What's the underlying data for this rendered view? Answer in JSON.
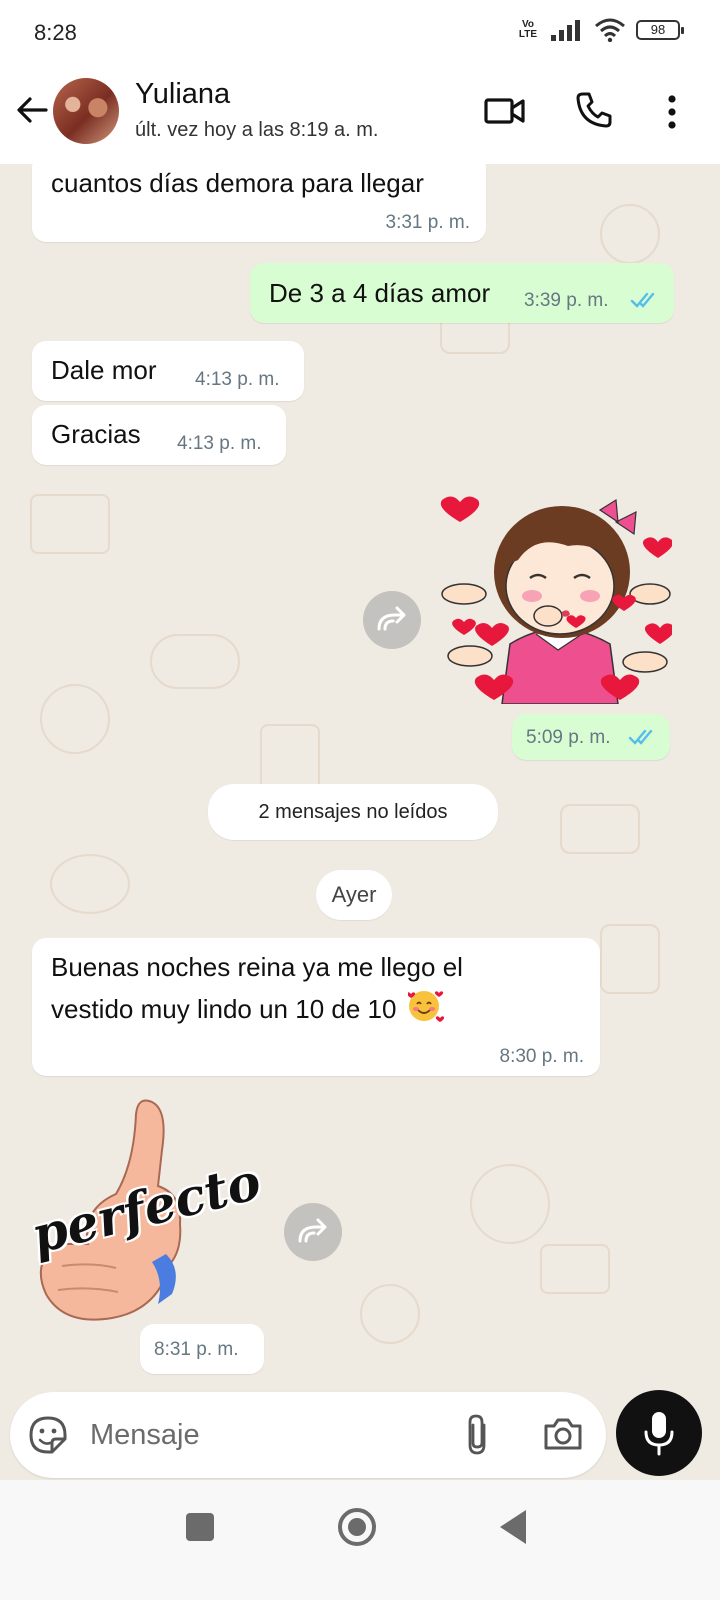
{
  "status_bar": {
    "time": "8:28",
    "network": "Vo LTE",
    "battery": "98"
  },
  "header": {
    "contact_name": "Yuliana",
    "last_seen": "últ. vez hoy a las 8:19 a. m.",
    "icons": [
      "back-arrow-icon",
      "video-call-icon",
      "phone-call-icon",
      "more-vert-icon"
    ]
  },
  "messages": [
    {
      "direction": "in",
      "type": "text",
      "text": "cuantos días demora para llegar",
      "time": "3:31 p. m."
    },
    {
      "direction": "out",
      "type": "text",
      "text": "De 3 a 4 días amor",
      "time": "3:39 p. m.",
      "status": "read"
    },
    {
      "direction": "in",
      "type": "text",
      "text": "Dale mor",
      "time": "4:13 p. m."
    },
    {
      "direction": "in",
      "type": "text",
      "text": "Gracias",
      "time": "4:13 p. m."
    },
    {
      "direction": "out",
      "type": "sticker",
      "sticker": "girl-blowing-kisses-hearts",
      "time": "5:09 p. m.",
      "status": "read"
    },
    {
      "direction": "in",
      "type": "text",
      "text_line1": "Buenas noches reina ya me llego el",
      "text_line2": "vestido muy lindo un 10 de 10",
      "emoji": "🥰",
      "time": "8:30 p. m."
    },
    {
      "direction": "in",
      "type": "sticker",
      "sticker": "thumbs-up-perfecto",
      "sticker_text": "perfecto",
      "time": "8:31 p. m."
    }
  ],
  "unread_divider": "2 mensajes no leídos",
  "date_divider": "Ayer",
  "composer": {
    "placeholder": "Mensaje"
  },
  "colors": {
    "outgoing_bubble": "#d9fdd3",
    "incoming_bubble": "#ffffff",
    "read_ticks": "#53bdeb",
    "background": "#efeae2"
  }
}
